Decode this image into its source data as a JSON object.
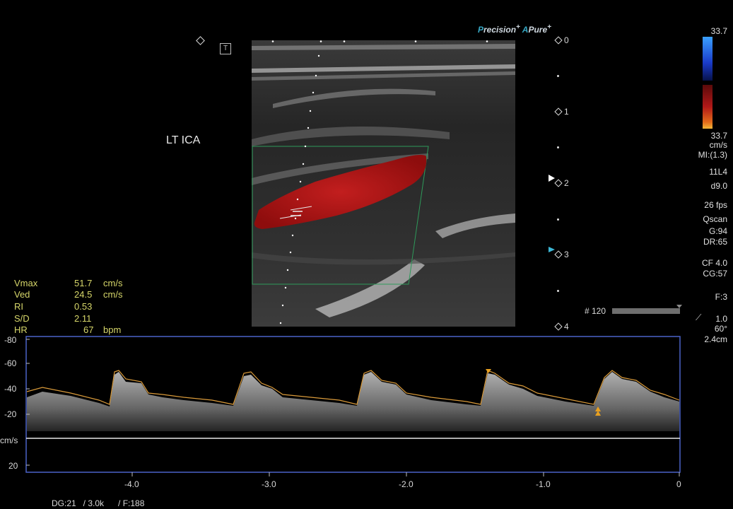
{
  "brand": {
    "precision_p": "P",
    "precision_rest": "recision",
    "a_letter": "A",
    "pure": "Pure",
    "plus": "+"
  },
  "probe_marker": "T",
  "vessel_label": "LT ICA",
  "depth_scale": [
    "0",
    "1",
    "2",
    "3",
    "4"
  ],
  "color_bar": {
    "top": "33.7",
    "bottom": "33.7",
    "unit": "cm/s"
  },
  "settings": [
    "MI:(1.3)",
    "11L4",
    "d9.0",
    "26 fps",
    "Qscan",
    "G:94",
    "DR:65",
    "CF 4.0",
    "CG:57",
    "F:3"
  ],
  "angle": {
    "value1": "1.0",
    "value2": "60°",
    "value3": "2.4cm"
  },
  "frame_counter": "# 120",
  "measurements": [
    {
      "label": "Vmax",
      "value": "51.7",
      "unit": "cm/s"
    },
    {
      "label": "Ved",
      "value": "24.5",
      "unit": "cm/s"
    },
    {
      "label": "RI",
      "value": "0.53",
      "unit": ""
    },
    {
      "label": "S/D",
      "value": "2.11",
      "unit": ""
    },
    {
      "label": "HR",
      "value": "67",
      "unit": "bpm"
    }
  ],
  "spectral": {
    "y_ticks": [
      "-80",
      "-60",
      "-40",
      "-20",
      "cm/s",
      "20"
    ],
    "x_ticks": [
      "-4.0",
      "-3.0",
      "-2.0",
      "-1.0",
      "0"
    ],
    "bottom_info": "DG:21   / 3.0k      / F:188"
  },
  "colors": {
    "frame": "#4a63c8",
    "envelope": "#d99a3a",
    "flow": "#b3161a",
    "roi": "#2e9a5a",
    "measure": "#d7d76a"
  }
}
